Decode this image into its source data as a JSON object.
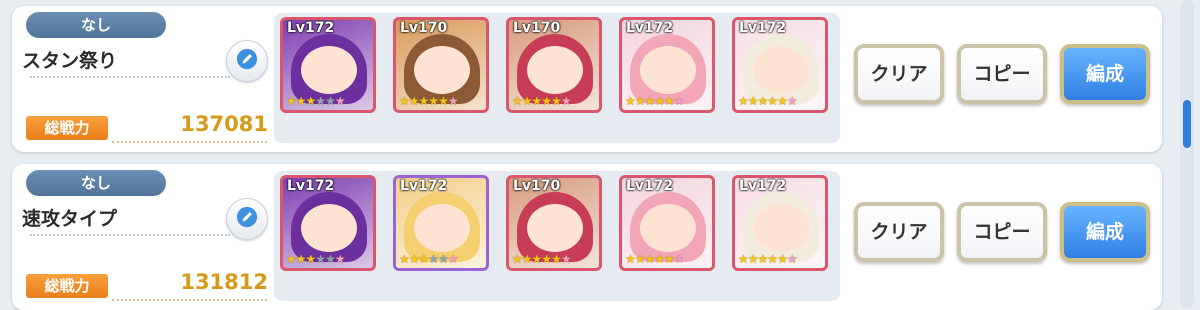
{
  "parties": [
    {
      "tag": "なし",
      "name": "スタン祭り",
      "power_label": "総戦力",
      "power": "137081",
      "units": [
        {
          "level": "Lv172",
          "stars": 3,
          "frame": "red",
          "color_bg": "#7e3fb0",
          "hair": "#6b2f9e"
        },
        {
          "level": "Lv170",
          "stars": 5,
          "frame": "red",
          "color_bg": "#d99a5a",
          "hair": "#8e5a36"
        },
        {
          "level": "Lv170",
          "stars": 5,
          "frame": "red",
          "color_bg": "#d89b7e",
          "hair": "#c63d55"
        },
        {
          "level": "Lv172",
          "stars": 5,
          "frame": "red",
          "color_bg": "#f2d5dd",
          "hair": "#f2a6b8"
        },
        {
          "level": "Lv172",
          "stars": 5,
          "frame": "red",
          "color_bg": "#f7dfe4",
          "hair": "#f4eddd"
        }
      ],
      "buttons": {
        "clear": "クリア",
        "copy": "コピー",
        "edit": "編成"
      }
    },
    {
      "tag": "なし",
      "name": "速攻タイプ",
      "power_label": "総戦力",
      "power": "131812",
      "units": [
        {
          "level": "Lv172",
          "stars": 3,
          "frame": "red",
          "color_bg": "#7e3fb0",
          "hair": "#6b2f9e"
        },
        {
          "level": "Lv172",
          "stars": 3,
          "frame": "purple",
          "color_bg": "#f2d08a",
          "hair": "#f6cf70"
        },
        {
          "level": "Lv170",
          "stars": 5,
          "frame": "red",
          "color_bg": "#d89b7e",
          "hair": "#c63d55"
        },
        {
          "level": "Lv172",
          "stars": 5,
          "frame": "red",
          "color_bg": "#f2d5dd",
          "hair": "#f2a6b8"
        },
        {
          "level": "Lv172",
          "stars": 5,
          "frame": "red",
          "color_bg": "#f7dfe4",
          "hair": "#f4eddd"
        }
      ],
      "buttons": {
        "clear": "クリア",
        "copy": "コピー",
        "edit": "編成"
      }
    }
  ],
  "colors": {
    "accent_blue": "#2f7fe2",
    "power_orange": "#ea7f1b",
    "power_gold": "#d59a17"
  },
  "icons": {
    "edit": "pencil-icon",
    "star": "star-icon"
  }
}
